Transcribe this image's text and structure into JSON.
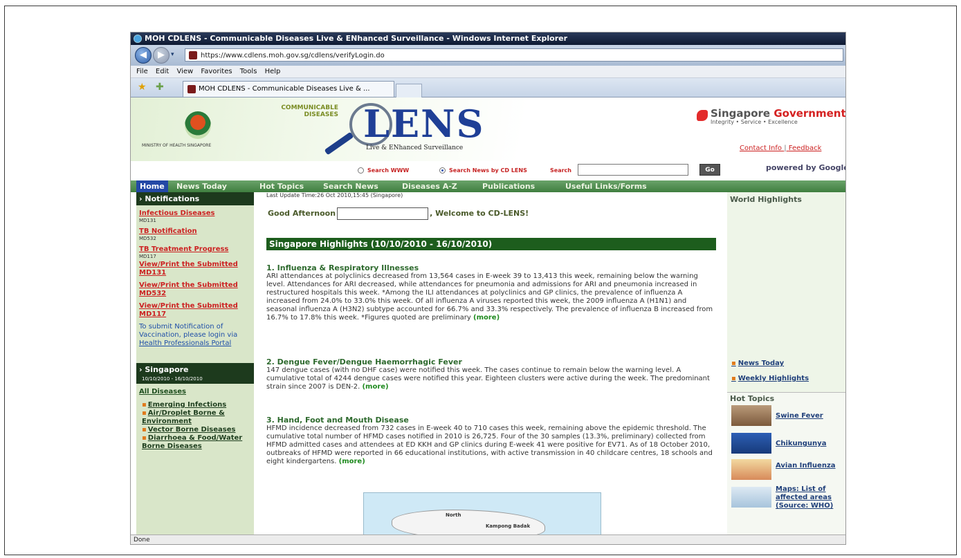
{
  "window": {
    "title": "MOH CDLENS - Communicable Diseases Live & ENhanced Surveillance - Windows Internet Explorer",
    "url": "https://www.cdlens.moh.gov.sg/cdlens/verifyLogin.do",
    "menu": [
      "File",
      "Edit",
      "View",
      "Favorites",
      "Tools",
      "Help"
    ],
    "tab_label": "MOH CDLENS - Communicable Diseases Live & ...",
    "status": "Done"
  },
  "banner": {
    "ministry": "MINISTRY OF HEALTH SINGAPORE",
    "cd_label": "COMMUNICABLE DISEASES",
    "lens": "LENS",
    "lens_sub": "Live & ENhanced Surveillance",
    "gov_prefix": "Singapore",
    "gov_suffix": "Government",
    "motto": "Integrity • Service • Excellence",
    "contact": "Contact Info",
    "sep": "|",
    "feedback": "Feedback"
  },
  "search": {
    "opt_www": "Search WWW",
    "opt_news": "Search News by CD LENS",
    "label": "Search",
    "go": "Go",
    "powered": "powered by Google"
  },
  "nav": [
    "Home",
    "News Today",
    "Hot Topics",
    "Search News",
    "Diseases A-Z",
    "Publications",
    "Useful Links/Forms"
  ],
  "left": {
    "notif_title": "Notifications",
    "links": [
      {
        "label": "Infectious Diseases",
        "code": "MD131"
      },
      {
        "label": "TB Notification",
        "code": "MD532"
      },
      {
        "label": "TB Treatment Progress",
        "code": "MD117"
      }
    ],
    "print_links": [
      "View/Print the Submitted MD131",
      "View/Print the Submitted MD532",
      "View/Print the Submitted MD117"
    ],
    "vacc_note": "To submit Notification of Vaccination, please login via",
    "vacc_link": "Health Professionals Portal",
    "sg_title": "Singapore",
    "sg_dates": "10/10/2010 - 16/10/2010",
    "all_diseases": "All Diseases",
    "categories": [
      "Emerging Infections",
      "Air/Droplet Borne & Environment",
      "Vector Borne Diseases",
      "Diarrhoea & Food/Water Borne Diseases"
    ]
  },
  "center": {
    "last_update": "Last Update Time:26 Oct 2010,15:45 (Singapore)",
    "greeting": "Good Afternoon",
    "welcome": ", Welcome to CD-LENS!",
    "highlights_title": "Singapore Highlights (10/10/2010 - 16/10/2010)",
    "sections": [
      {
        "title": "1. Influenza & Respiratory Illnesses",
        "body": "ARI attendances at polyclinics decreased from 13,564 cases in E-week 39 to 13,413 this week, remaining below the warning level. Attendances for ARI decreased, while attendances for pneumonia and admissions for ARI and pneumonia increased in restructured hospitals this week. *Among the ILI attendances at polyclinics and GP clinics, the prevalence of influenza A increased from 24.0% to 33.0% this week. Of all influenza A viruses reported this week, the 2009 influenza A (H1N1) and seasonal influenza A (H3N2) subtype accounted for 66.7% and 33.3% respectively. The prevalence of influenza B increased from 16.7% to 17.8% this week. *Figures quoted are preliminary",
        "more": "(more)"
      },
      {
        "title": "2. Dengue Fever/Dengue Haemorrhagic Fever",
        "body": "147 dengue cases (with no DHF case) were notified this week. The cases continue to remain below the warning level. A cumulative total of 4244 dengue cases were notified this year. Eighteen clusters were active during the week. The predominant strain since 2007 is DEN-2.",
        "more": "(more)"
      },
      {
        "title": "3. Hand, Foot and Mouth Disease",
        "body": "HFMD incidence decreased from 732 cases in E-week 40 to 710 cases this week, remaining above the epidemic threshold. The cumulative total number of HFMD cases notified in 2010 is 26,725. Four of the 30 samples (13.3%, preliminary) collected from HFMD admitted cases and attendees at ED KKH and GP clinics during E-week 41 were positive for EV71. As of 18 October 2010, outbreaks of HFMD were reported in 66 educational institutions, with active transmission in 40 childcare centres, 18 schools and eight kindergartens.",
        "more": "(more)"
      }
    ],
    "map_label_1": "North",
    "map_label_2": "Kampong Badak"
  },
  "right": {
    "world_title": "World Highlights",
    "news_today": "News Today",
    "weekly": "Weekly Highlights",
    "hot_title": "Hot Topics",
    "hot": [
      "Swine Fever",
      "Chikungunya",
      "Avian Influenza",
      "Maps: List of affected areas (Source: WHO)"
    ]
  }
}
